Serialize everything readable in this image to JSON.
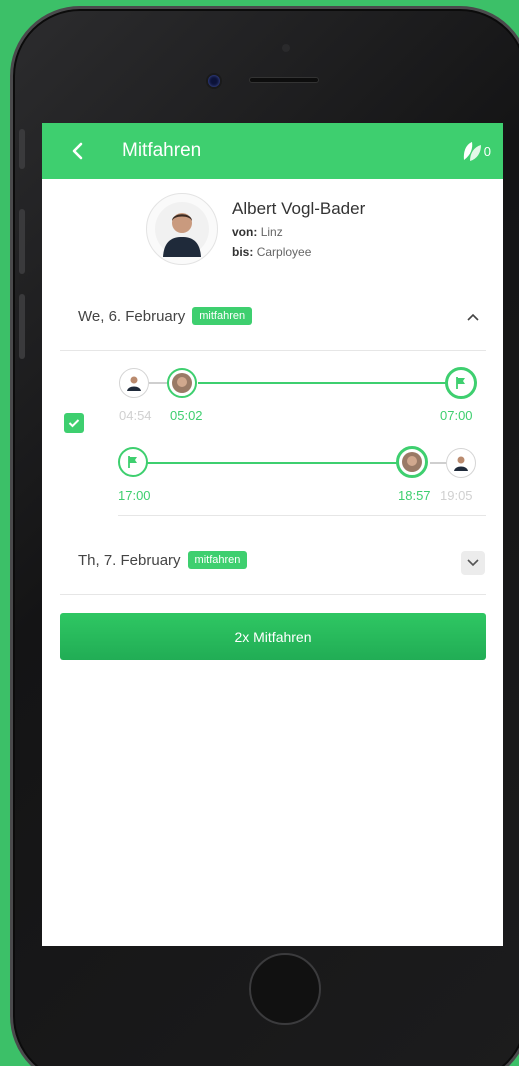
{
  "appbar": {
    "title": "Mitfahren",
    "leaf_count": "0"
  },
  "driver": {
    "name": "Albert Vogl-Bader",
    "from_label": "von:",
    "from": "Linz",
    "to_label": "bis:",
    "to": "Carployee"
  },
  "days": [
    {
      "label": "We, 6. February",
      "badge": "mitfahren",
      "expanded": true
    },
    {
      "label": "Th, 7. February",
      "badge": "mitfahren",
      "expanded": false
    }
  ],
  "trips": {
    "outbound": {
      "driver_time": "04:54",
      "pickup_time": "05:02",
      "arrival_time": "07:00"
    },
    "return": {
      "departure_time": "17:00",
      "dropoff_time": "18:57",
      "driver_time": "19:05"
    }
  },
  "action": {
    "label": "2x Mitfahren"
  },
  "colors": {
    "accent": "#3ecf6f",
    "background": "#3cc068"
  }
}
